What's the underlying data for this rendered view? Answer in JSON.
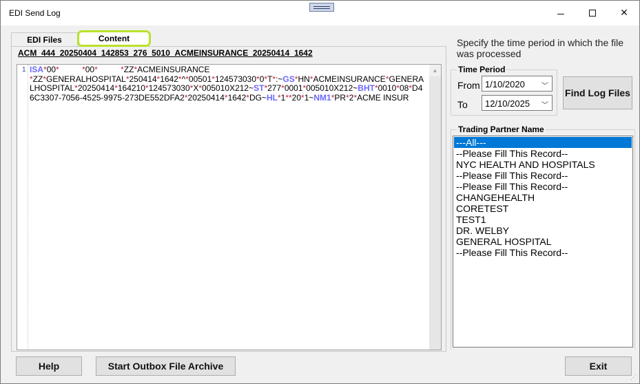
{
  "window": {
    "title": "EDI Send Log",
    "minimize_glyph": "",
    "maximize_glyph": "",
    "close_glyph": "✕"
  },
  "tabs": [
    {
      "label": "EDI Files"
    },
    {
      "label": "Content"
    }
  ],
  "content": {
    "filename": "ACM_444_20250404_142853_276_5010_ACMEINSURANCE_20250414_1642",
    "line_number": "1",
    "lines": [
      "ISA*00*          *00*          *ZZ*ACMEINSURANCE",
      "*ZZ*GENERALHOSPITAL*250414*1642*^*00501*124573030*0*T*:~GS*HN*ACMEINSURANCE*GENERA",
      "LHOSPITAL*20250414*164210*124573030*X*005010X212~ST*277*0001*005010X212~BHT*0010*08*D4",
      "6C3307-7056-4525-9975-273DE552DFA2*20250414*1642*DG~HL*1**20*1~NM1*PR*2*ACME INSUR"
    ]
  },
  "time_period": {
    "instructions": "Specify the time period in which the file was processed",
    "group_label": "Time Period",
    "from_label": "From",
    "from_value": "1/10/2020",
    "to_label": "To",
    "to_value": "12/10/2025"
  },
  "buttons": {
    "find_log_files": "Find Log Files",
    "help": "Help",
    "start_archive": "Start Outbox File Archive",
    "exit": "Exit"
  },
  "trading_partner": {
    "label": "Trading Partner Name",
    "selected_index": 0,
    "items": [
      "---All---",
      "--Please Fill This Record--",
      "NYC HEALTH AND HOSPITALS",
      "--Please Fill This Record--",
      "--Please Fill This Record--",
      "CHANGEHEALTH",
      "CORETEST",
      "TEST1",
      "DR. WELBY",
      "GENERAL HOSPITAL",
      "--Please Fill This Record--"
    ]
  }
}
